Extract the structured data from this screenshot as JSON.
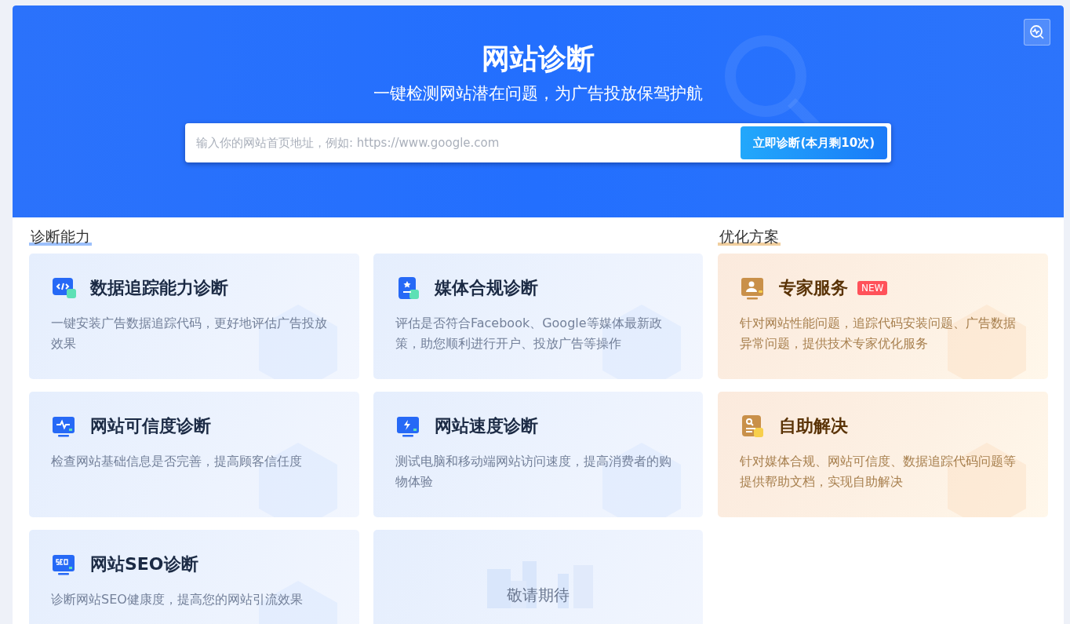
{
  "hero": {
    "title": "网站诊断",
    "subtitle": "一键检测网站潜在问题，为广告投放保驾护航",
    "search": {
      "placeholder": "输入你的网站首页地址，例如: https://www.google.com"
    },
    "button": "立即诊断(本月剩10次)"
  },
  "diagnosis": {
    "heading": "诊断能力",
    "cards": [
      {
        "kind": "tracking",
        "title": "数据追踪能力诊断",
        "description": "一键安装广告数据追踪代码，更好地评估广告投放效果"
      },
      {
        "kind": "compliance",
        "title": "媒体合规诊断",
        "description": "评估是否符合Facebook、Google等媒体最新政策，助您顺利进行开户、投放广告等操作"
      },
      {
        "kind": "trust",
        "title": "网站可信度诊断",
        "description": "检查网站基础信息是否完善，提高顾客信任度"
      },
      {
        "kind": "speed",
        "title": "网站速度诊断",
        "description": "测试电脑和移动端网站访问速度，提高消费者的购物体验"
      },
      {
        "kind": "seo",
        "title": "网站SEO诊断",
        "description": "诊断网站SEO健康度，提高您的网站引流效果"
      },
      {
        "kind": "coming",
        "title": "敬请期待"
      }
    ]
  },
  "solutions": {
    "heading": "优化方案",
    "cards": [
      {
        "kind": "expert",
        "title": "专家服务",
        "badge": "NEW",
        "description": "针对网站性能问题，追踪代码安装问题、广告数据异常问题，提供技术专家优化服务"
      },
      {
        "kind": "selfhelp",
        "title": "自助解决",
        "description": "针对媒体合规、网站可信度、数据追踪代码问题等提供帮助文档，实现自助解决"
      }
    ]
  }
}
